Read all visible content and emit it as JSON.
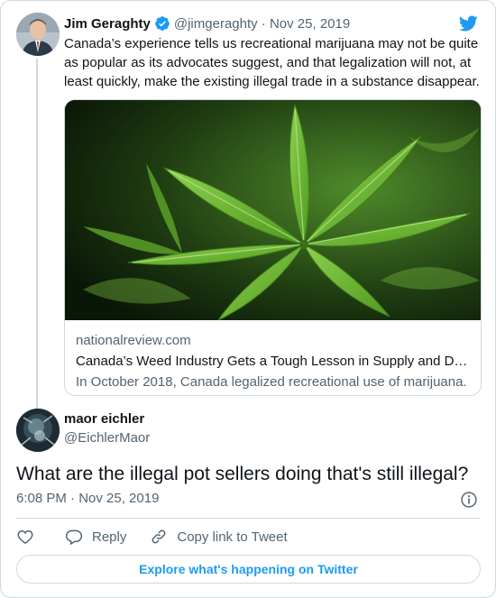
{
  "tweet": {
    "author_name": "Jim Geraghty",
    "author_handle": "@jimgeraghty · Nov 25, 2019",
    "text": "Canada’s experience tells us recreational marijuana may not be quite as popular as its advocates suggest, and that legalization will not, at least quickly, make the existing illegal trade in a substance disappear.",
    "link_card": {
      "domain": "nationalreview.com",
      "title": "Canada’s Weed Industry Gets a Tough Lesson in Supply and D…",
      "description": "In October 2018, Canada legalized recreational use of marijuana."
    }
  },
  "reply": {
    "author_name": "maor eichler",
    "author_handle": "@EichlerMaor",
    "text": "What are the illegal pot sellers doing that's still illegal?",
    "timestamp": "6:08 PM · Nov 25, 2019"
  },
  "actions": {
    "reply_label": "Reply",
    "copy_link_label": "Copy link to Tweet"
  },
  "explore_label": "Explore what's happening on Twitter",
  "colors": {
    "accent": "#1d9bf0",
    "text": "#0f1419",
    "muted": "#536471",
    "border": "#cfd9de"
  },
  "icons": [
    "verified-badge-icon",
    "twitter-bird-icon",
    "info-icon",
    "heart-icon",
    "reply-bubble-icon",
    "link-icon"
  ]
}
